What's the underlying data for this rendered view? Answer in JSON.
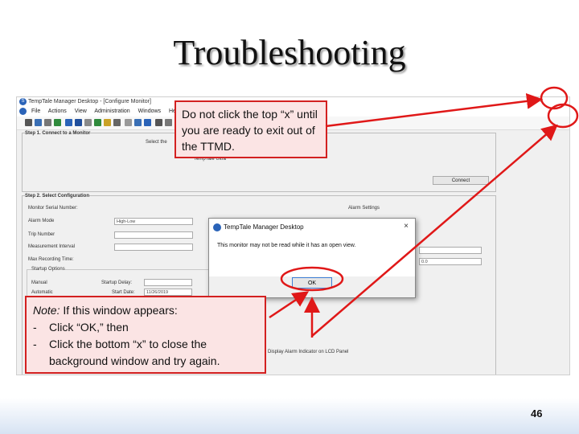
{
  "slide": {
    "title": "Troubleshooting",
    "page_number": "46"
  },
  "app": {
    "window_title": "TempTale Manager Desktop - [Configure Monitor]",
    "menu": [
      "File",
      "Actions",
      "View",
      "Administration",
      "Windows",
      "Help"
    ],
    "step1": {
      "label": "Step 1. Connect to a Monitor",
      "select_prompt": "Select the",
      "device": "TempTale Ultra",
      "connect_button": "Connect"
    },
    "step2": {
      "label": "Step 2. Select Configuration",
      "monitor_serial_label": "Monitor Serial Number:",
      "alarm_mode_label": "Alarm Mode",
      "alarm_mode_value": "High-Low",
      "trip_number_label": "Trip Number",
      "measurement_interval_label": "Measurement Interval",
      "max_recording_label": "Max Recording Time:",
      "startup_options_label": "Startup Options",
      "manual_label": "Manual",
      "automatic_label": "Automatic",
      "startup_delay_label": "Startup Delay:",
      "start_date_label": "Start Date:",
      "start_date_value": "11/26/2019",
      "alarm_settings_label": "Alarm Settings",
      "numeric_value": "0.0",
      "lcd_label": "Display Alarm Indicator on LCD Panel"
    },
    "dialog": {
      "title": "TempTale Manager Desktop",
      "close": "×",
      "message": "This monitor may not be read while it has an open view.",
      "ok": "OK"
    }
  },
  "callouts": {
    "top": "Do not click the top “x” until you are ready to exit out of the TTMD.",
    "bottom": {
      "note_label": "Note:",
      "note_text": " If this window appears:",
      "items": [
        "Click “OK,” then",
        "Click the bottom “x” to close the background window and try again."
      ],
      "bullet": "-"
    }
  },
  "colors": {
    "callout_border": "#d32020",
    "callout_fill": "#fbe4e4",
    "arrow": "#e01818"
  }
}
